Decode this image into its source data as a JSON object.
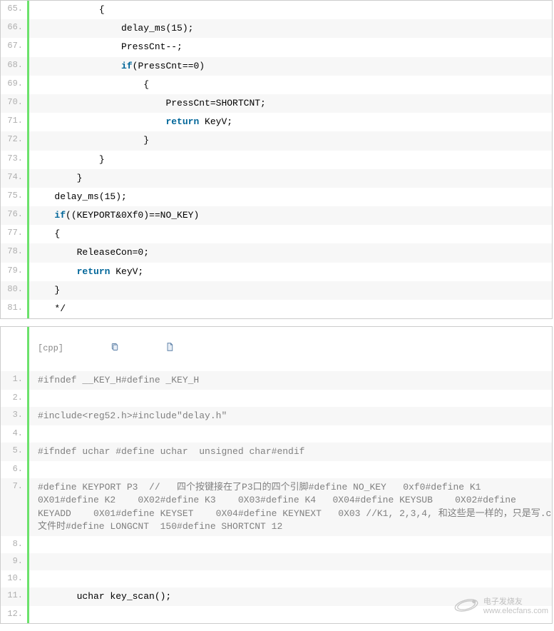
{
  "block1": {
    "start": 65,
    "lines": [
      "           {",
      "               delay_ms(15);",
      "               PressCnt--;",
      "               if(PressCnt==0)",
      "                   {",
      "                       PressCnt=SHORTCNT;",
      "                       return KeyV;",
      "                   }",
      "           }",
      "       }",
      "   delay_ms(15);",
      "   if((KEYPORT&0Xf0)==NO_KEY)",
      "   {",
      "       ReleaseCon=0;",
      "       return KeyV;",
      "   }",
      "   */"
    ]
  },
  "block2": {
    "header_label": "[cpp]",
    "lines": {
      "l1": "#ifndef __KEY_H#define _KEY_H",
      "l2": "",
      "l3": "#include<reg52.h>#include\"delay.h\"",
      "l4": "",
      "l5": "#ifndef uchar #define uchar  unsigned char#endif",
      "l6": "",
      "l7": "#define KEYPORT P3  //   四个按键接在了P3口的四个引脚#define NO_KEY   0xf0#define K1    0X01#define K2    0X02#define K3    0X03#define K4   0X04#define KEYSUB    0X02#define KEYADD    0X01#define KEYSET    0X04#define KEYNEXT   0X03 //K1, 2,3,4, 和这些是一样的，只是写.c文件时#define LONGCNT  150#define SHORTCNT 12",
      "l8": "",
      "l9": "",
      "l10": "",
      "l11": "       uchar key_scan();",
      "l12": ""
    }
  },
  "watermark": {
    "title": "电子发烧友",
    "url": "www.elecfans.com"
  }
}
